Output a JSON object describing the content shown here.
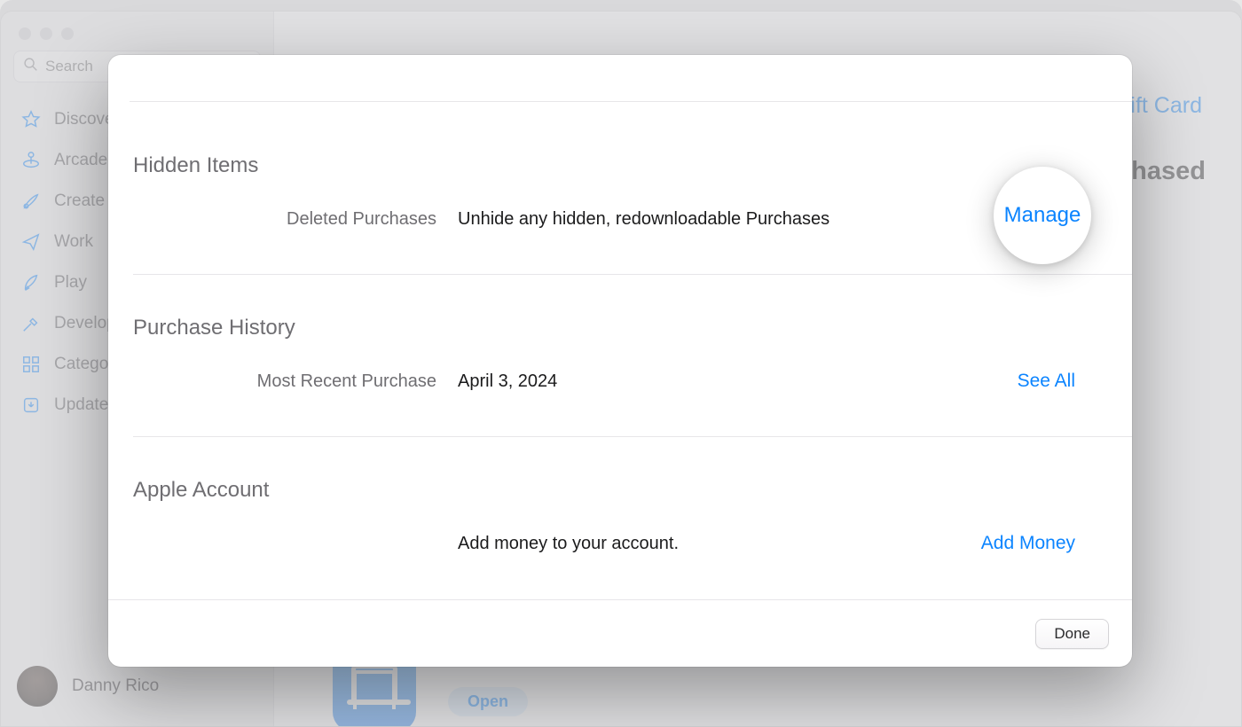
{
  "sidebar": {
    "search_placeholder": "Search",
    "items": [
      {
        "label": "Discover",
        "icon": "star"
      },
      {
        "label": "Arcade",
        "icon": "arcade"
      },
      {
        "label": "Create",
        "icon": "brush"
      },
      {
        "label": "Work",
        "icon": "paperplane"
      },
      {
        "label": "Play",
        "icon": "rocket"
      },
      {
        "label": "Develop",
        "icon": "hammer"
      },
      {
        "label": "Categories",
        "icon": "grid"
      },
      {
        "label": "Updates",
        "icon": "download"
      }
    ],
    "user_name": "Danny Rico"
  },
  "content": {
    "top_right_link": "Redeem Gift Card",
    "purchased_label": "Purchased",
    "open_button": "Open"
  },
  "sheet": {
    "sections": {
      "hidden_items": {
        "title": "Hidden Items",
        "row_label": "Deleted Purchases",
        "row_value": "Unhide any hidden, redownloadable Purchases",
        "action": "Manage"
      },
      "purchase_history": {
        "title": "Purchase History",
        "row_label": "Most Recent Purchase",
        "row_value": "April 3, 2024",
        "action": "See All"
      },
      "apple_account": {
        "title": "Apple Account",
        "row_label": "",
        "row_value": "Add money to your account.",
        "action": "Add Money"
      }
    },
    "done": "Done"
  }
}
